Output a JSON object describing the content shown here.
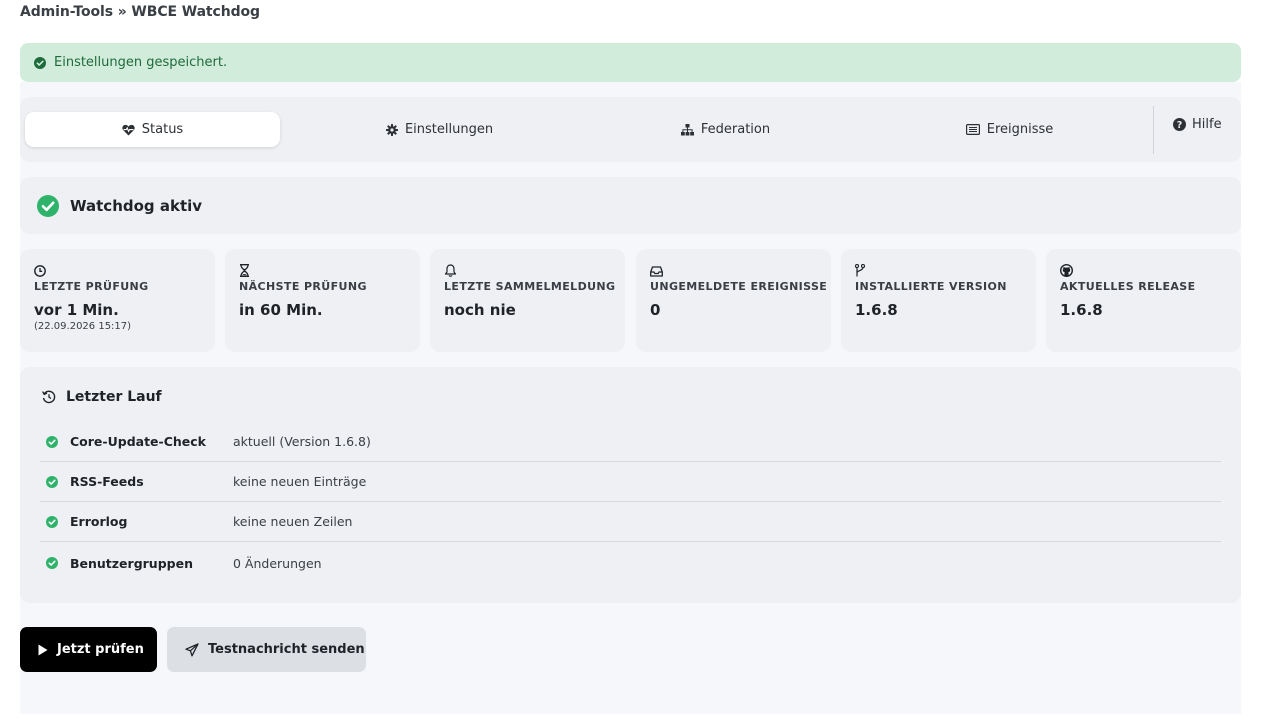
{
  "breadcrumb": "Admin-Tools » WBCE Watchdog",
  "alert": {
    "text": "Einstellungen gespeichert.",
    "icon": "check-circle-icon"
  },
  "tabs": [
    {
      "label": "Status",
      "icon": "heartbeat-icon",
      "active": true
    },
    {
      "label": "Einstellungen",
      "icon": "gear-icon",
      "active": false
    },
    {
      "label": "Federation",
      "icon": "sitemap-icon",
      "active": false
    },
    {
      "label": "Ereignisse",
      "icon": "list-icon",
      "active": false
    }
  ],
  "help": {
    "label": "Hilfe",
    "icon": "question-circle-icon"
  },
  "status": {
    "title": "Watchdog aktiv",
    "icon": "check-circle-icon"
  },
  "cards": [
    {
      "label": "Letzte Prüfung",
      "value": "vor 1 Min.",
      "sub": "(22.09.2026 15:17)",
      "icon": "clock-icon"
    },
    {
      "label": "Nächste Prüfung",
      "value": "in 60 Min.",
      "icon": "hourglass-icon"
    },
    {
      "label": "Letzte Sammelmeldung",
      "value": "noch nie",
      "icon": "bell-icon"
    },
    {
      "label": "Ungemeldete Ereignisse",
      "value": "0",
      "icon": "inbox-icon"
    },
    {
      "label": "Installierte Version",
      "value": "1.6.8",
      "icon": "code-branch-icon"
    },
    {
      "label": "Aktuelles Release",
      "value": "1.6.8",
      "icon": "github-icon"
    }
  ],
  "last_run": {
    "title": "Letzter Lauf",
    "icon": "history-icon",
    "rows": [
      {
        "name": "Core-Update-Check",
        "value": "aktuell (Version 1.6.8)"
      },
      {
        "name": "RSS-Feeds",
        "value": "keine neuen Einträge"
      },
      {
        "name": "Errorlog",
        "value": "keine neuen Zeilen"
      },
      {
        "name": "Benutzergruppen",
        "value": "0 Änderungen"
      }
    ]
  },
  "buttons": {
    "check_now": "Jetzt prüfen",
    "send_test": "Testnachricht senden"
  },
  "colors": {
    "success": "#2fb36b",
    "alert_bg": "#d2ecdc",
    "alert_text": "#1e6b3b",
    "panel_bg": "#eef0f4"
  }
}
